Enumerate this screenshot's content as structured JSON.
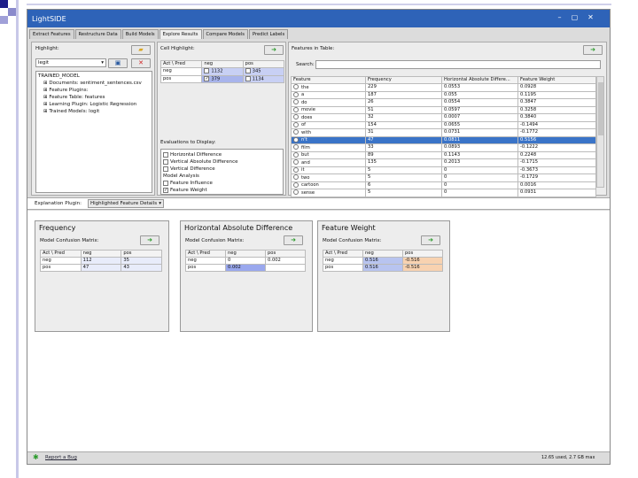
{
  "app": {
    "title": "LightSIDE"
  },
  "window_controls": {
    "minimize": "–",
    "maximize": "▢",
    "close": "✕"
  },
  "tabs": [
    "Extract Features",
    "Restructure Data",
    "Build Models",
    "Explore Results",
    "Compare Models",
    "Predict Labels"
  ],
  "left": {
    "highlight_label": "Highlight:",
    "highlight_value": "legit",
    "tree": [
      "TRAINED_MODEL",
      "Documents: sentiment_sentences.csv",
      "Feature Plugins:",
      "Feature Table: features",
      "Learning Plugin: Logistic Regression",
      "Trained Models: logit"
    ]
  },
  "cell_highlight": {
    "label": "Cell Highlight:",
    "headers": [
      "Act \\ Pred",
      "neg",
      "pos"
    ],
    "rows": [
      [
        "neg",
        "1132",
        "345"
      ],
      [
        "pos",
        "379",
        "1134"
      ]
    ]
  },
  "evaluations": {
    "label": "Evaluations to Display:",
    "items": [
      "Horizontal Difference",
      "Vertical Absolute Difference",
      "Vertical Difference"
    ],
    "section": "Model Analysis",
    "analysis_items": [
      "Feature Influence",
      "Feature Weight"
    ],
    "check_mark": "✓"
  },
  "features": {
    "label": "Features in Table:",
    "search_label": "Search:",
    "search_value": "",
    "headers": [
      "Feature",
      "Frequency",
      "Horizontal Absolute Differe...",
      "Feature Weight"
    ],
    "rows": [
      [
        "the",
        "229",
        "0.0553",
        "0.0928"
      ],
      [
        "a",
        "187",
        "0.055",
        "0.1195"
      ],
      [
        "do",
        "26",
        "0.0554",
        "0.3847"
      ],
      [
        "movie",
        "51",
        "0.0597",
        "0.3258"
      ],
      [
        "does",
        "32",
        "0.0007",
        "0.3840"
      ],
      [
        "of",
        "154",
        "0.0655",
        "-0.1494"
      ],
      [
        "with",
        "31",
        "0.0731",
        "-0.1772"
      ],
      [
        "n't",
        "47",
        "0.0811",
        "0.5156"
      ],
      [
        "film",
        "33",
        "0.0893",
        "-0.1222"
      ],
      [
        "but",
        "89",
        "0.1143",
        "0.2248"
      ],
      [
        "and",
        "135",
        "0.2013",
        "-0.1715"
      ],
      [
        "it",
        "5",
        "0",
        "-0.3673"
      ],
      [
        "two",
        "5",
        "0",
        "-0.1729"
      ],
      [
        "cartoon",
        "6",
        "0",
        "0.0016"
      ],
      [
        "sense",
        "5",
        "0",
        "0.0931"
      ]
    ]
  },
  "explanation": {
    "label": "Explanation Plugin:",
    "value": "Highlighted Feature Details"
  },
  "cards": [
    {
      "title": "Frequency",
      "matrix_label": "Model Confusion Matrix:",
      "headers": [
        "Act \\ Pred",
        "neg",
        "pos"
      ],
      "rows": [
        [
          "neg",
          "112",
          "35"
        ],
        [
          "pos",
          "47",
          "43"
        ]
      ]
    },
    {
      "title": "Horizontal Absolute Difference",
      "matrix_label": "Model Confusion Matrix:",
      "headers": [
        "Act \\ Pred",
        "neg",
        "pos"
      ],
      "rows": [
        [
          "neg",
          "0",
          "0.002"
        ],
        [
          "pos",
          "0.002",
          ""
        ]
      ]
    },
    {
      "title": "Feature Weight",
      "matrix_label": "Model Confusion Matrix:",
      "headers": [
        "Act \\ Pred",
        "neg",
        "pos"
      ],
      "rows": [
        [
          "neg",
          "0.516",
          "-0.516"
        ],
        [
          "pos",
          "0.516",
          "-0.516"
        ]
      ]
    }
  ],
  "status": {
    "report": "Report a Bug",
    "memory": "12.65 used, 2.7 GB max"
  },
  "icons": {
    "folder": "folder-open-icon",
    "save": "save-icon",
    "delete": "delete-icon",
    "arrow": "green-arrow-icon",
    "bug": "bug-icon"
  },
  "colors": {
    "titlebar": "#2e63b8",
    "selected_row": "#3a74c8",
    "cell_blue": "#b8c4f0",
    "cell_orange": "#f8d2b0"
  }
}
